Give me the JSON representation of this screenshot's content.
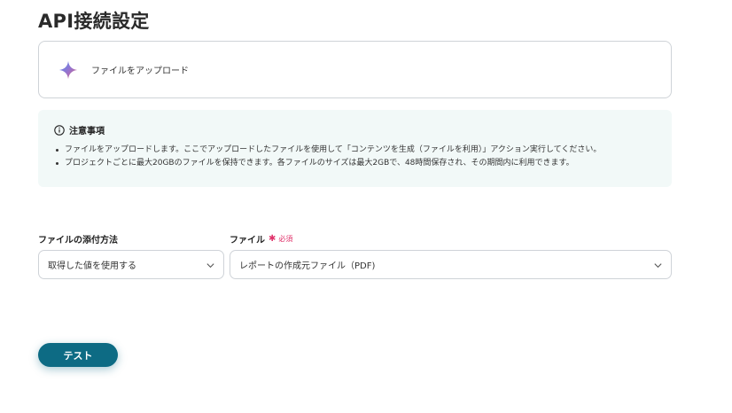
{
  "page": {
    "title": "API接続設定"
  },
  "action": {
    "label": "ファイルをアップロード",
    "icon": "sparkle-icon"
  },
  "notice": {
    "heading": "注意事項",
    "items": [
      "ファイルをアップロードします。ここでアップロードしたファイルを使用して「コンテンツを生成（ファイルを利用）」アクション実行してください。",
      "プロジェクトごとに最大20GBのファイルを保持できます。各ファイルのサイズは最大2GBで、48時間保存され、その期間内に利用できます。"
    ]
  },
  "fields": {
    "method": {
      "label": "ファイルの添付方法",
      "value": "取得した値を使用する"
    },
    "file": {
      "label": "ファイル",
      "required_mark": "✱",
      "required_text": "必須",
      "value": "レポートの作成元ファイル（PDF)"
    }
  },
  "test_button": {
    "label": "テスト"
  },
  "colors": {
    "accent": "#0d6b84",
    "required": "#e0336b",
    "notice_bg": "#f2f9f8",
    "border": "#cfd3d8"
  }
}
